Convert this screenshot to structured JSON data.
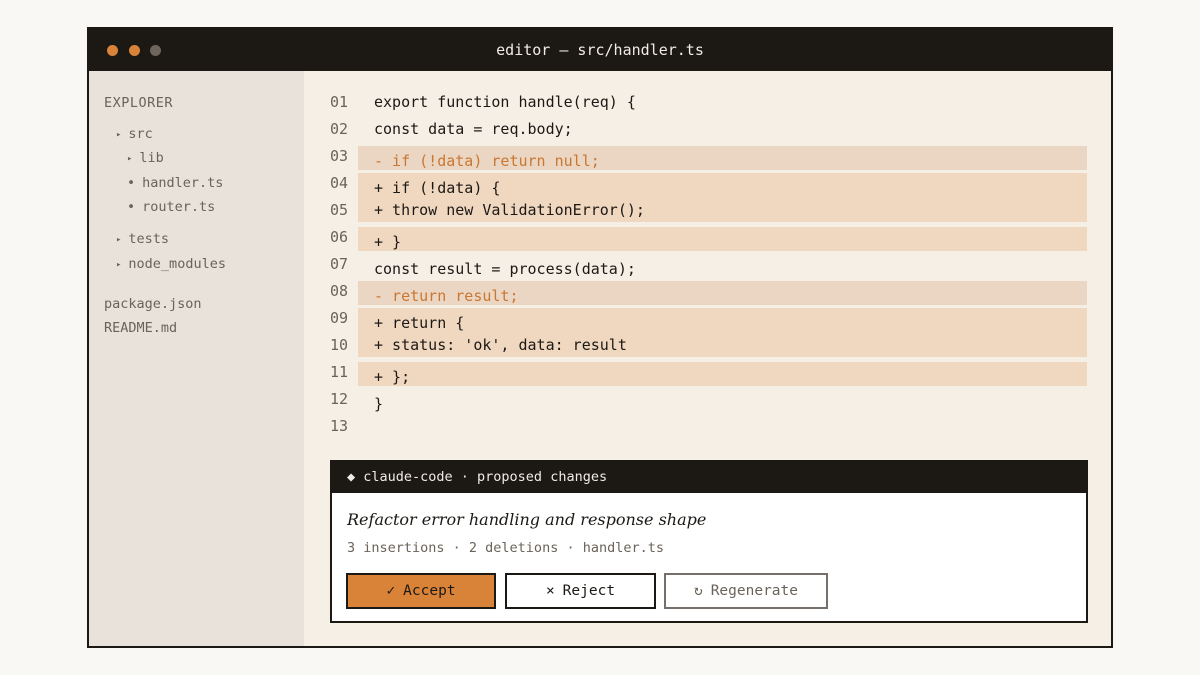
{
  "window": {
    "title": "editor — src/handler.ts",
    "controls": [
      "close",
      "minimize",
      "maximize"
    ]
  },
  "sidebar": {
    "heading": "EXPLORER",
    "tree": [
      {
        "label": "src",
        "type": "folder",
        "marker": "▸"
      },
      {
        "label": "lib",
        "type": "folder",
        "marker": "▸"
      },
      {
        "label": "handler.ts",
        "type": "file",
        "marker": "•"
      },
      {
        "label": "router.ts",
        "type": "file",
        "marker": "•"
      },
      {
        "label": "tests",
        "type": "folder",
        "marker": "▸"
      },
      {
        "label": "node_modules",
        "type": "folder",
        "marker": "▸"
      },
      {
        "label": "package.json",
        "type": "file"
      },
      {
        "label": "README.md",
        "type": "file"
      }
    ]
  },
  "editor": {
    "lines": [
      {
        "num": "01",
        "text": "export function handle(req) {",
        "kind": "normal"
      },
      {
        "num": "02",
        "text": "const data = req.body;",
        "kind": "normal"
      },
      {
        "num": "03",
        "text": "- if (!data) return null;",
        "kind": "del"
      },
      {
        "num": "04",
        "text": "+ if (!data) {",
        "kind": "add"
      },
      {
        "num": "05",
        "text": "+ throw new ValidationError();",
        "kind": "add"
      },
      {
        "num": "06",
        "text": "+ }",
        "kind": "add"
      },
      {
        "num": "07",
        "text": "const result = process(data);",
        "kind": "normal"
      },
      {
        "num": "08",
        "text": "- return result;",
        "kind": "del"
      },
      {
        "num": "09",
        "text": "+ return {",
        "kind": "add"
      },
      {
        "num": "10",
        "text": "+ status: 'ok', data: result",
        "kind": "add"
      },
      {
        "num": "11",
        "text": "+ };",
        "kind": "add"
      },
      {
        "num": "12",
        "text": "}",
        "kind": "normal"
      },
      {
        "num": "13",
        "text": "",
        "kind": "normal"
      }
    ]
  },
  "panel": {
    "header": "◆ claude-code · proposed changes",
    "title": "Refactor error handling and response shape",
    "meta": "3 insertions · 2 deletions · handler.ts",
    "accept": {
      "icon": "✓",
      "label": "Accept"
    },
    "reject": {
      "icon": "×",
      "label": "Reject"
    },
    "regenerate": {
      "icon": "↻",
      "label": "Regenerate"
    }
  },
  "colors": {
    "titlebar": "#1c1915",
    "accent": "#d98339",
    "deletion_text": "#c97733",
    "deletion_bg": "#ead6c2",
    "insertion_bg": "#f0d7c0",
    "sidebar_bg": "#e9e2da",
    "editor_bg": "#f5efe6"
  }
}
